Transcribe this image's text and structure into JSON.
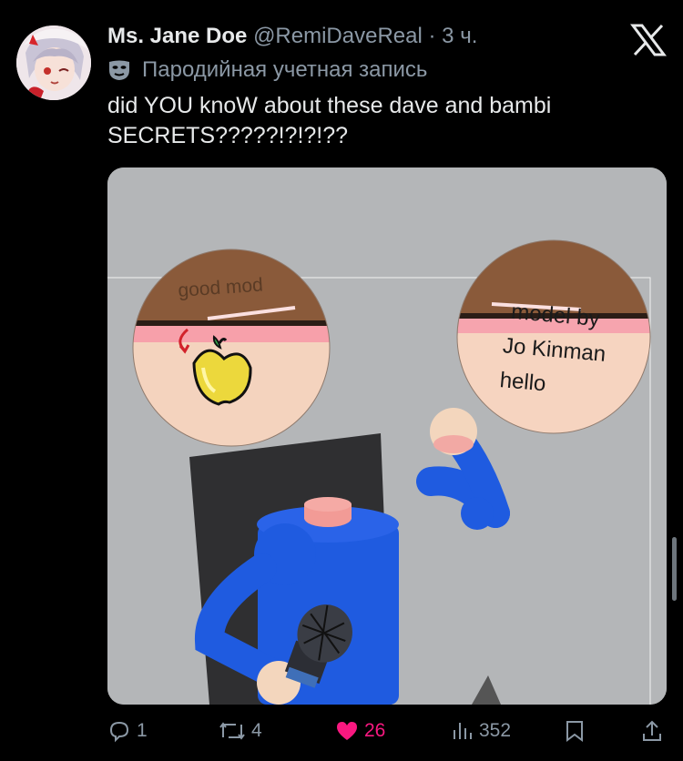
{
  "tweet": {
    "display_name": "Ms. Jane Doe",
    "handle": "@RemiDaveReal",
    "separator": "·",
    "time": "3 ч.",
    "parody_label": "Пародийная учетная запись",
    "text": "did YOU knoW about these dave and bambi SECRETS?????!?!?!??"
  },
  "media": {
    "left_circle_text": "good mod",
    "right_circle_lines": [
      "model by",
      "Jo Kinman",
      "hello"
    ]
  },
  "actions": {
    "replies": "1",
    "reposts": "4",
    "likes": "26",
    "views": "352"
  },
  "colors": {
    "background": "#000000",
    "text": "#e7e9ea",
    "secondary": "#8b98a5",
    "like": "#f91880",
    "media_bg": "#b4b6b8",
    "character_blue": "#1f5be0"
  },
  "icons": {
    "brand": "x-logo-icon",
    "parody": "mask-icon",
    "reply": "reply-icon",
    "repost": "repost-icon",
    "like": "heart-icon",
    "views": "views-icon",
    "bookmark": "bookmark-icon",
    "share": "share-icon"
  }
}
